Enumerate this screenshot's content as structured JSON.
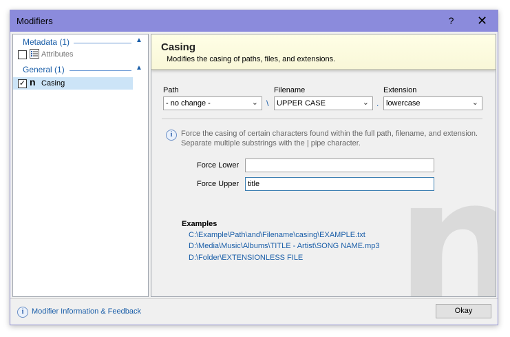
{
  "window": {
    "title": "Modifiers",
    "help_glyph": "?",
    "close_glyph": "✕"
  },
  "sidebar": {
    "groups": [
      {
        "label": "Metadata (1)",
        "items": [
          {
            "label": "Attributes",
            "checked": false,
            "icon": "list-icon"
          }
        ]
      },
      {
        "label": "General (1)",
        "items": [
          {
            "label": "Casing",
            "checked": true,
            "icon": "casing-n-icon",
            "selected": true
          }
        ]
      }
    ],
    "collapse_glyph": "▲",
    "casing_icon_glyph": "n",
    "check_glyph": "✓"
  },
  "header": {
    "title": "Casing",
    "subtitle": "Modifies the casing of paths, files, and extensions."
  },
  "fields": {
    "path_label": "Path",
    "path_value": "- no change -",
    "filename_label": "Filename",
    "filename_value": "UPPER CASE",
    "extension_label": "Extension",
    "extension_value": "lowercase",
    "sep1": "\\",
    "sep2": "."
  },
  "info": {
    "line1": "Force the casing of certain characters found within the full path, filename, and extension.",
    "line2": "Separate multiple substrings with the | pipe character."
  },
  "force": {
    "lower_label": "Force Lower",
    "lower_value": "",
    "upper_label": "Force Upper",
    "upper_value": "title"
  },
  "examples": {
    "title": "Examples",
    "items": [
      "C:\\Example\\Path\\and\\Filename\\casing\\EXAMPLE.txt",
      "D:\\Media\\Music\\Albums\\TITLE - Artist\\SONG NAME.mp3",
      "D:\\Folder\\EXTENSIONLESS FILE"
    ]
  },
  "watermark": "n",
  "footer": {
    "link": "Modifier Information & Feedback",
    "okay": "Okay"
  },
  "colors": {
    "titlebar": "#8b8bdc",
    "link": "#1a5ea8",
    "header_bg": "#ffffe6",
    "selection": "#cce4f7"
  }
}
